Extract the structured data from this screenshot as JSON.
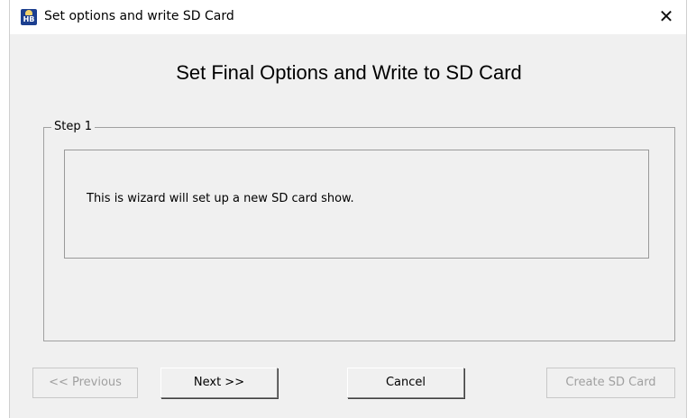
{
  "window": {
    "title": "Set options and write SD Card",
    "close_glyph": "✕",
    "icon": "hb-app-icon"
  },
  "main": {
    "heading": "Set Final Options and Write to SD Card",
    "group_label": "Step 1",
    "info_text": "This is wizard will set up a new SD card show."
  },
  "buttons": {
    "previous": "<< Previous",
    "next": "Next >>",
    "cancel": "Cancel",
    "create": "Create SD Card"
  }
}
